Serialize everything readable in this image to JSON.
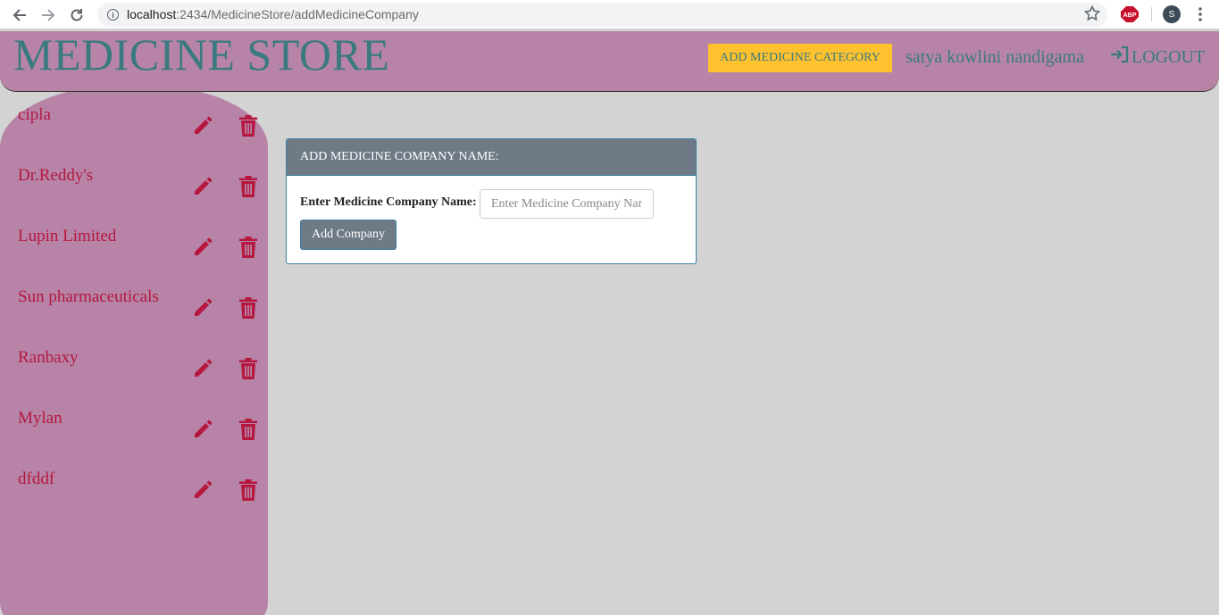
{
  "browser": {
    "url_host": "localhost",
    "url_rest": ":2434/MedicineStore/addMedicineCompany",
    "abp_label": "ABP",
    "profile_initial": "S"
  },
  "header": {
    "brand": "MEDICINE STORE",
    "add_category_label": "ADD MEDICINE CATEGORY",
    "username": "satya kowlini nandigama",
    "logout_label": "LOGOUT"
  },
  "sidebar": {
    "companies": [
      {
        "name": "cipla"
      },
      {
        "name": "Dr.Reddy's"
      },
      {
        "name": "Lupin Limited"
      },
      {
        "name": "Sun pharmaceuticals"
      },
      {
        "name": "Ranbaxy"
      },
      {
        "name": "Mylan"
      },
      {
        "name": "dfddf"
      }
    ]
  },
  "form": {
    "title": "ADD MEDICINE COMPANY NAME:",
    "label": "Enter Medicine Company Name:",
    "placeholder": "Enter Medicine Company Name",
    "value": "",
    "submit_label": "Add Company"
  },
  "colors": {
    "header_bg": "#b784a7",
    "brand_text": "#3a7a7f",
    "accent_button": "#ffc12e",
    "company_text": "#b5173f",
    "page_bg": "#d3d3d3",
    "card_header": "#6f7a87"
  }
}
